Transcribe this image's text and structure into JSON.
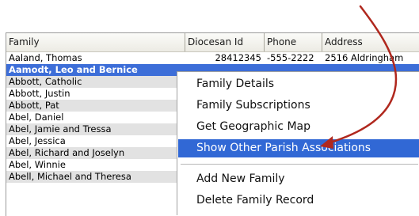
{
  "columns": {
    "family": "Family",
    "diocesan_id": "Diocesan Id",
    "phone": "Phone",
    "address": "Address"
  },
  "rows": [
    {
      "family": "Aaland, Thomas",
      "diocesan_id": "28412345",
      "phone": "-555-2222",
      "address": "2516 Aldringham"
    },
    {
      "family": "Aamodt, Leo and Bernice",
      "selected": true
    },
    {
      "family": "Abbott, Catholic"
    },
    {
      "family": "Abbott, Justin"
    },
    {
      "family": "Abbott, Pat"
    },
    {
      "family": "Abel, Daniel"
    },
    {
      "family": "Abel, Jamie and Tressa"
    },
    {
      "family": "Abel, Jessica"
    },
    {
      "family": "Abel, Richard and Joselyn"
    },
    {
      "family": "Abel, Winnie"
    },
    {
      "family": "Abell, Michael and  Theresa"
    }
  ],
  "context_menu": {
    "items": [
      {
        "label": "Family Details"
      },
      {
        "label": "Family Subscriptions"
      },
      {
        "label": "Get Geographic Map"
      },
      {
        "label": "Show Other Parish Associations",
        "highlighted": true
      },
      {
        "label": "Add New Family"
      },
      {
        "label": "Delete Family Record"
      }
    ]
  },
  "colors": {
    "selection": "#3d6ed8",
    "menu_highlight": "#3168d5",
    "annotation_arrow": "#b0281e"
  }
}
